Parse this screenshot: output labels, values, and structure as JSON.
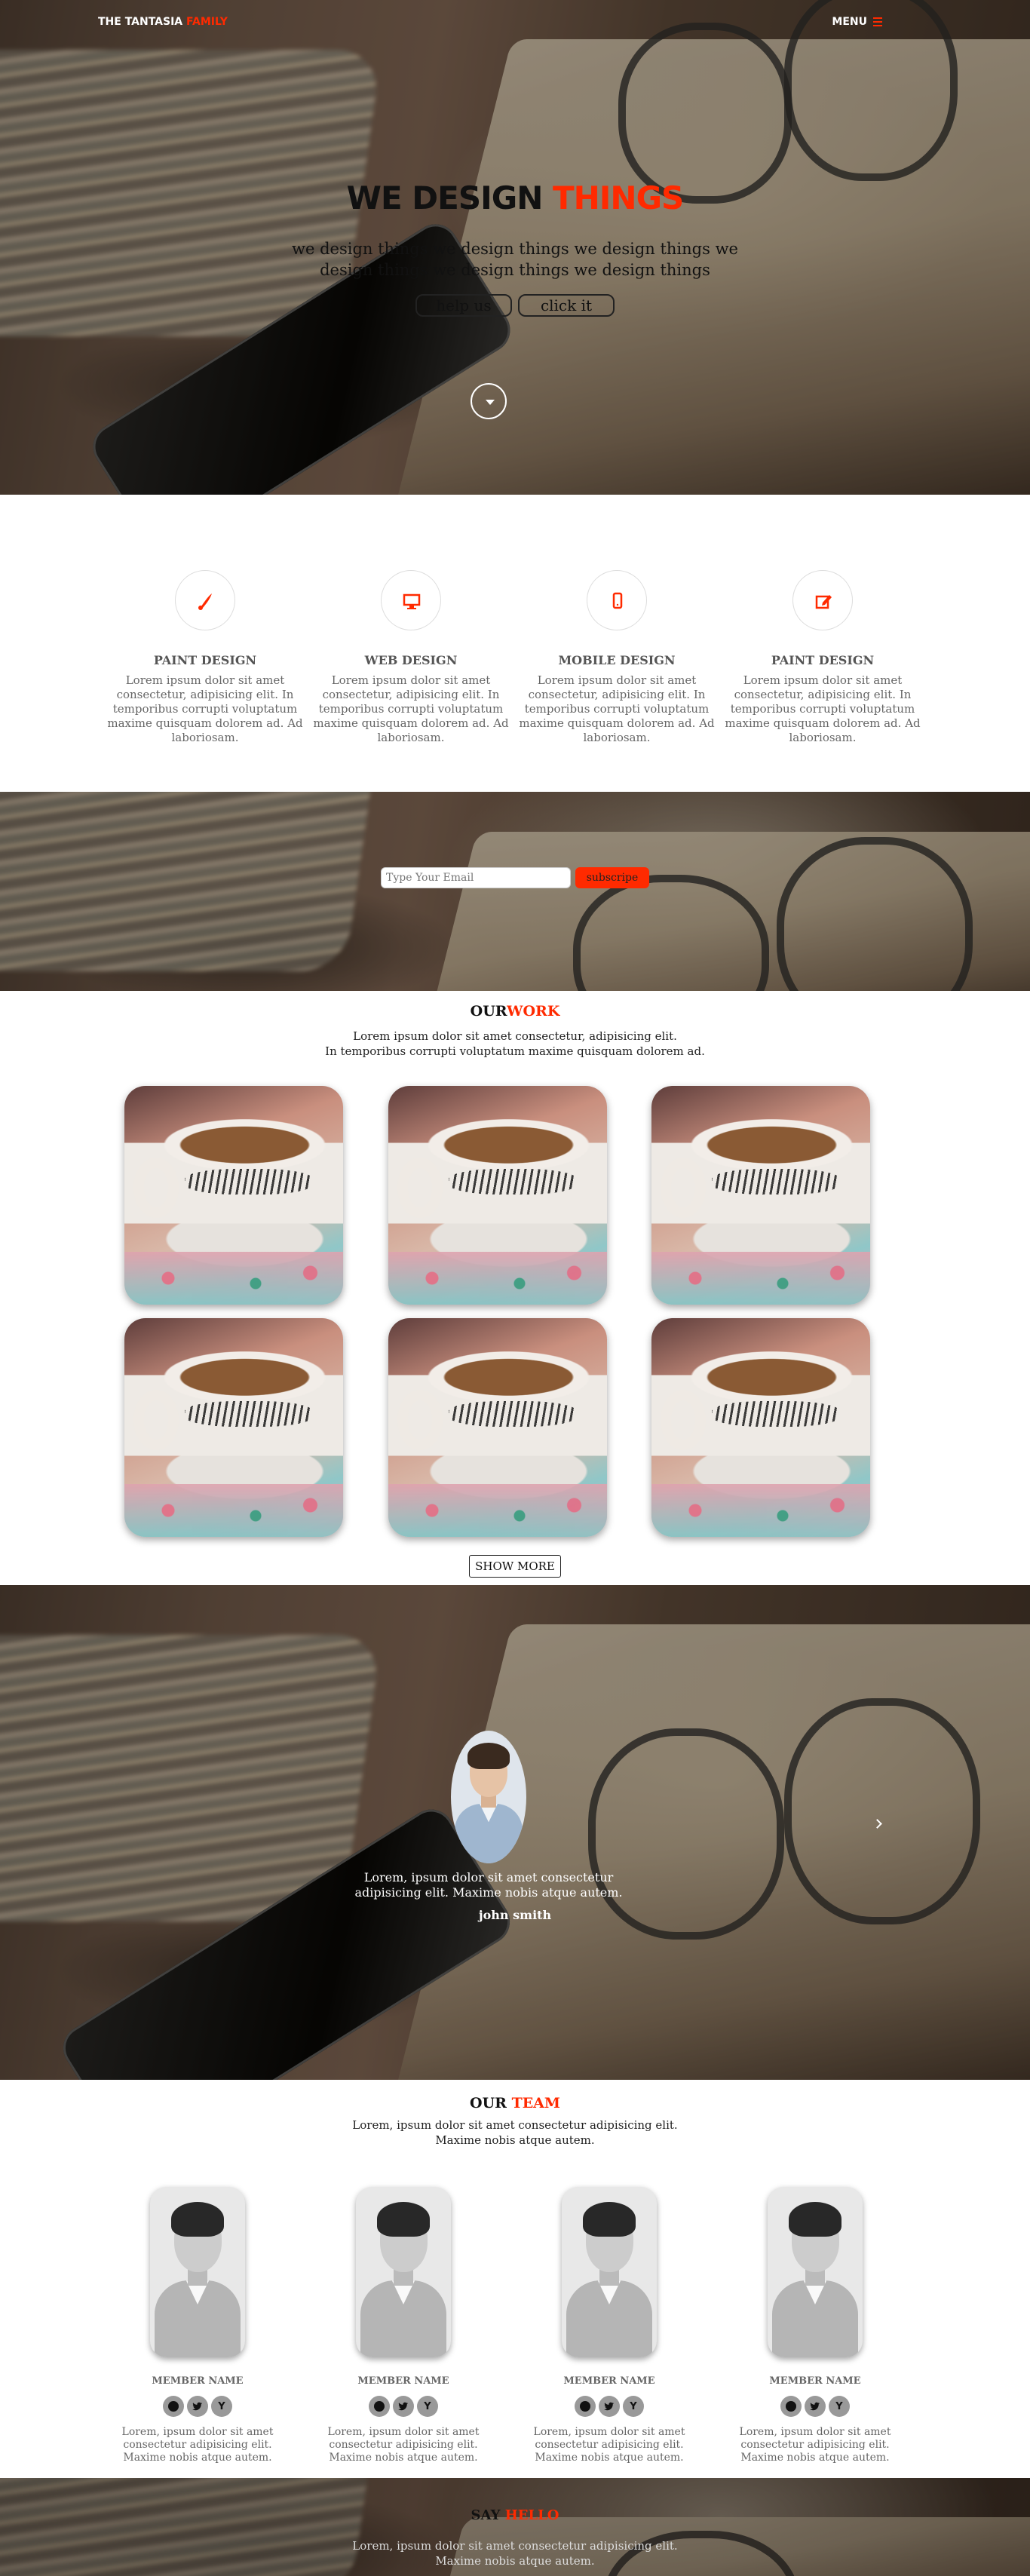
{
  "header": {
    "logo_main": "THE TANTASIA ",
    "logo_accent": "FAMILY",
    "menu_label": "MENU"
  },
  "hero": {
    "title_main": "WE DESIGN ",
    "title_accent": "THINGS",
    "subtitle": "we design things we design things we design things we design things we design things we design things",
    "button_help": "help us",
    "button_click": "click it"
  },
  "services": [
    {
      "icon": "paint-brush-icon",
      "title": "PAINT DESIGN",
      "text": "Lorem ipsum dolor sit amet consectetur, adipisicing elit. In temporibus corrupti voluptatum maxime quisquam dolorem ad. Ad laboriosam."
    },
    {
      "icon": "monitor-icon",
      "title": "WEB DESIGN",
      "text": "Lorem ipsum dolor sit amet consectetur, adipisicing elit. In temporibus corrupti voluptatum maxime quisquam dolorem ad. Ad laboriosam."
    },
    {
      "icon": "mobile-icon",
      "title": "MOBILE DESIGN",
      "text": "Lorem ipsum dolor sit amet consectetur, adipisicing elit. In temporibus corrupti voluptatum maxime quisquam dolorem ad. Ad laboriosam."
    },
    {
      "icon": "edit-icon",
      "title": "PAINT DESIGN",
      "text": "Lorem ipsum dolor sit amet consectetur, adipisicing elit. In temporibus corrupti voluptatum maxime quisquam dolorem ad. Ad laboriosam."
    }
  ],
  "subscribe": {
    "placeholder": "Type Your Email",
    "button": "subscripe"
  },
  "work": {
    "title_main": "OUR",
    "title_accent": "WORK",
    "subtitle_line1": "Lorem ipsum dolor sit amet consectetur, adipisicing elit.",
    "subtitle_line2": "In temporibus corrupti voluptatum maxime quisquam dolorem ad.",
    "show_more": "SHOW MORE"
  },
  "testimonial": {
    "quote": "Lorem, ipsum dolor sit amet consectetur adipisicing elit. Maxime nobis atque autem.",
    "name": "john smith"
  },
  "team": {
    "title_main": "OUR ",
    "title_accent": "TEAM",
    "subtitle_line1": "Lorem, ipsum dolor sit amet consectetur adipisicing elit.",
    "subtitle_line2": "Maxime nobis atque autem.",
    "members": [
      {
        "name": "MEMBER NAME",
        "text": "Lorem, ipsum dolor sit amet consectetur adipisicing elit. Maxime nobis atque autem."
      },
      {
        "name": "MEMBER NAME",
        "text": "Lorem, ipsum dolor sit amet consectetur adipisicing elit. Maxime nobis atque autem."
      },
      {
        "name": "MEMBER NAME",
        "text": "Lorem, ipsum dolor sit amet consectetur adipisicing elit. Maxime nobis atque autem."
      },
      {
        "name": "MEMBER NAME",
        "text": "Lorem, ipsum dolor sit amet consectetur adipisicing elit. Maxime nobis atque autem."
      }
    ],
    "social_youtube_glyph": "Y"
  },
  "hello": {
    "title_main": "SAY ",
    "title_accent": "HELLO",
    "subtitle_line1": "Lorem, ipsum dolor sit amet consectetur adipisicing elit.",
    "subtitle_line2": "Maxime nobis atque autem."
  },
  "colors": {
    "accent": "#ff2a00",
    "text_dark": "#111111",
    "text_muted": "#666666"
  }
}
